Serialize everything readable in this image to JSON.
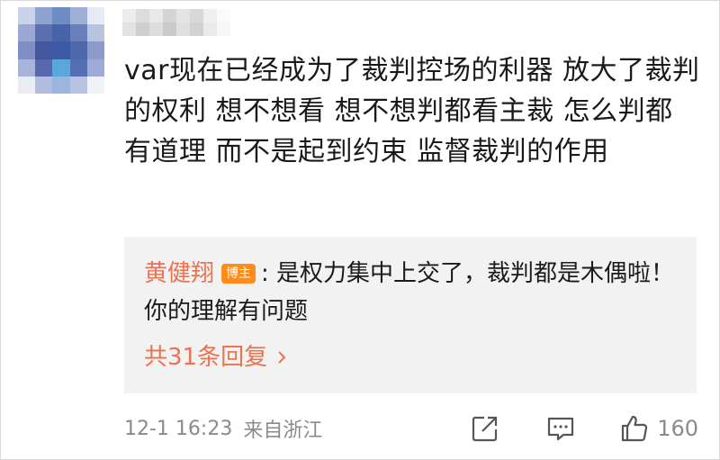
{
  "comment": {
    "text": "var现在已经成为了裁判控场的利器 放大了裁判的权利 想不想看 想不想判都看主裁 怎么判都有道理 而不是起到约束 监督裁判的作用"
  },
  "reply": {
    "author": "黄健翔",
    "badge": "博主",
    "text": ": 是权力集中上交了，裁判都是木偶啦！你的理解有问题",
    "count_label": "共31条回复"
  },
  "footer": {
    "timestamp": "12-1 16:23",
    "source": "来自浙江",
    "like_count": "160"
  },
  "colors": {
    "accent": "#eb7350",
    "badge": "#ff8c1a",
    "reply_bg": "#f2f2f2",
    "meta": "#8a8a8a"
  },
  "icons": [
    "chevron-right-icon",
    "share-icon",
    "comment-icon",
    "thumbs-up-icon"
  ]
}
